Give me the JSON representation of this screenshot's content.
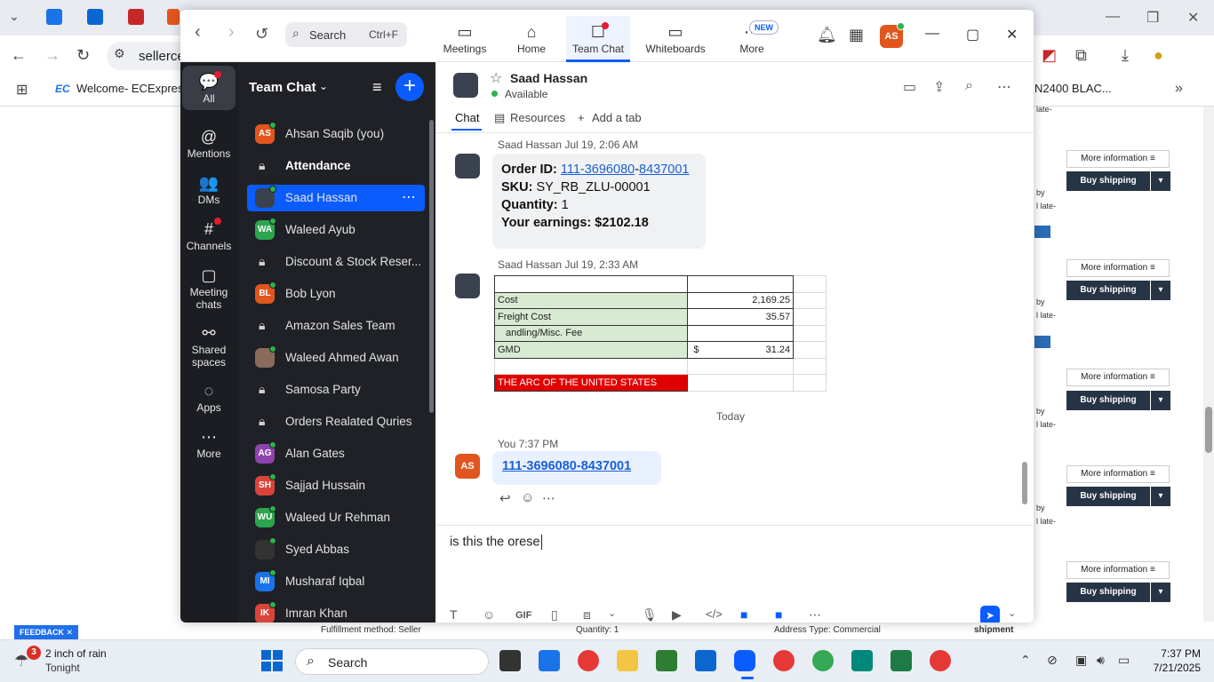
{
  "browser": {
    "url_text": "sellerce",
    "bookmark": "Welcome- ECExpres...",
    "bookmark_logo": "EC",
    "bookmark_right": "N2400 BLAC..."
  },
  "page": {
    "more_info_label": "More information ≡",
    "buy_shipping_label": "Buy shipping",
    "frag_late": "late-",
    "frag_by": "by",
    "frag_l_late": "l late-",
    "bottom_fulfillment": "Fulfillment method: Seller",
    "bottom_quantity": "Quantity: 1",
    "bottom_address": "Address Type: Commercial",
    "bottom_shipment": "shipment",
    "feedback": "FEEDBACK ✕"
  },
  "zoom": {
    "search_label": "Search",
    "search_shortcut": "Ctrl+F",
    "tabs": [
      {
        "label": "Meetings",
        "icon": "▭"
      },
      {
        "label": "Home",
        "icon": "⌂"
      },
      {
        "label": "Team Chat",
        "icon": "☐"
      },
      {
        "label": "Whiteboards",
        "icon": "▭"
      },
      {
        "label": "More",
        "icon": "⋯"
      }
    ],
    "new_badge": "NEW",
    "avatar_initials": "AS",
    "rail": [
      {
        "label": "All",
        "icon": "💬"
      },
      {
        "label": "Mentions",
        "icon": "@"
      },
      {
        "label": "DMs",
        "icon": "👥"
      },
      {
        "label": "Channels",
        "icon": "#"
      },
      {
        "label": "Meeting chats",
        "icon": "▢"
      },
      {
        "label": "Shared spaces",
        "icon": "⚯"
      },
      {
        "label": "Apps",
        "icon": "◌"
      },
      {
        "label": "More",
        "icon": "⋯"
      }
    ],
    "list_title": "Team Chat",
    "contacts": [
      {
        "name": "Ahsan Saqib (you)",
        "initials": "AS",
        "color": "#e0561e",
        "type": "avatar"
      },
      {
        "name": "Attendance",
        "type": "lock",
        "bold": true
      },
      {
        "name": "Saad Hassan",
        "initials": "",
        "color": "#3a4250",
        "type": "avatar",
        "selected": true
      },
      {
        "name": "Waleed Ayub",
        "initials": "WA",
        "color": "#2da44e",
        "type": "avatar"
      },
      {
        "name": "Discount & Stock Reser...",
        "type": "lock"
      },
      {
        "name": "Bob Lyon",
        "initials": "BL",
        "color": "#e0561e",
        "type": "avatar"
      },
      {
        "name": "Amazon Sales Team",
        "type": "lock"
      },
      {
        "name": "Waleed Ahmed Awan",
        "initials": "",
        "color": "#8a6a5a",
        "type": "avatar"
      },
      {
        "name": "Samosa Party",
        "type": "lock"
      },
      {
        "name": "Orders Realated Quries",
        "type": "lock"
      },
      {
        "name": "Alan Gates",
        "initials": "AG",
        "color": "#8e44ad",
        "type": "avatar"
      },
      {
        "name": "Sajjad Hussain",
        "initials": "SH",
        "color": "#d9443a",
        "type": "avatar"
      },
      {
        "name": "Waleed Ur Rehman",
        "initials": "WU",
        "color": "#2da44e",
        "type": "avatar"
      },
      {
        "name": "Syed Abbas",
        "initials": "",
        "color": "#333",
        "type": "avatar"
      },
      {
        "name": "Musharaf Iqbal",
        "initials": "MI",
        "color": "#1a73e8",
        "type": "avatar"
      },
      {
        "name": "Imran Khan",
        "initials": "IK",
        "color": "#d9443a",
        "type": "avatar"
      }
    ],
    "chat": {
      "name": "Saad Hassan",
      "status": "Available",
      "tab_chat": "Chat",
      "tab_resources": "Resources",
      "tab_add": "Add a tab",
      "msg1_meta": "Saad Hassan Jul 19, 2:06 AM",
      "order_label": "Order ID: ",
      "order_part1": "111-3696080",
      "order_sep": "-",
      "order_part2": "8437001",
      "sku_label": "SKU: ",
      "sku_value": "SY_RB_ZLU-00001",
      "qty_label": "Quantity: ",
      "qty_value": "1",
      "earn_label": "Your earnings: $2102.18",
      "msg2_meta": "Saad Hassan Jul 19, 2:33 AM",
      "sheet": {
        "cost_label": "Cost",
        "cost_value": "2,169.25",
        "freight_label": "Freight Cost",
        "freight_value": "35.57",
        "handling_label": "andling/Misc. Fee",
        "gmd_label": "GMD",
        "gmd_currency": "$",
        "gmd_value": "31.24",
        "footer_label": "THE ARC OF THE UNITED STATES"
      },
      "today_label": "Today",
      "you_meta": "You 7:37 PM",
      "you_initials": "AS",
      "you_message": "111-3696080-8437001",
      "compose_text": "is this the orese"
    }
  },
  "taskbar": {
    "weather_badge": "3",
    "weather_line1": "2 inch of rain",
    "weather_line2": "Tonight",
    "search_label": "Search",
    "time": "7:37 PM",
    "date": "7/21/2025"
  }
}
